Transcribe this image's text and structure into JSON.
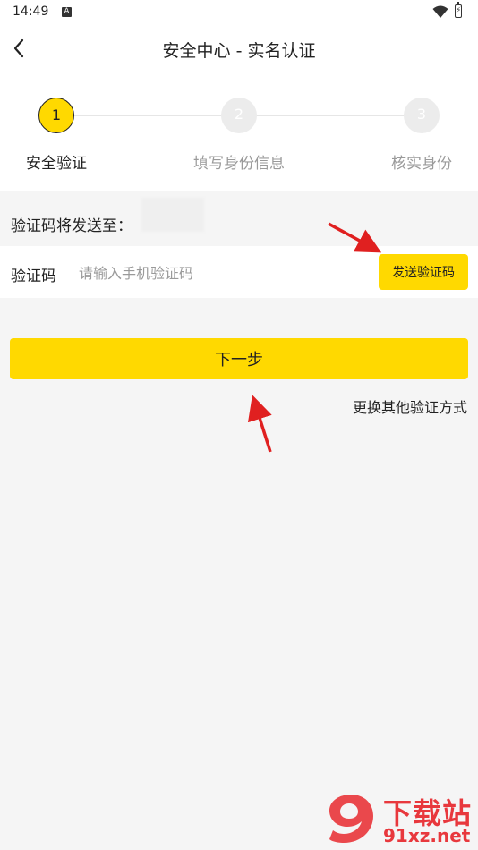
{
  "status": {
    "time": "14:49",
    "a_badge": "A"
  },
  "nav": {
    "title": "安全中心 - 实名认证"
  },
  "steps": [
    {
      "number": "1",
      "label": "安全验证",
      "active": true
    },
    {
      "number": "2",
      "label": "填写身份信息",
      "active": false
    },
    {
      "number": "3",
      "label": "核实身份",
      "active": false
    }
  ],
  "send_to": {
    "label": "验证码将发送至："
  },
  "code": {
    "label": "验证码",
    "placeholder": "请输入手机验证码",
    "send_button": "发送验证码"
  },
  "next_button": "下一步",
  "other_method_link": "更换其他验证方式",
  "watermark": {
    "line1": "下载站",
    "line2": "91xz.net"
  },
  "colors": {
    "accent": "#ffd900",
    "arrow": "#e02020",
    "watermark": "#e8383d"
  }
}
